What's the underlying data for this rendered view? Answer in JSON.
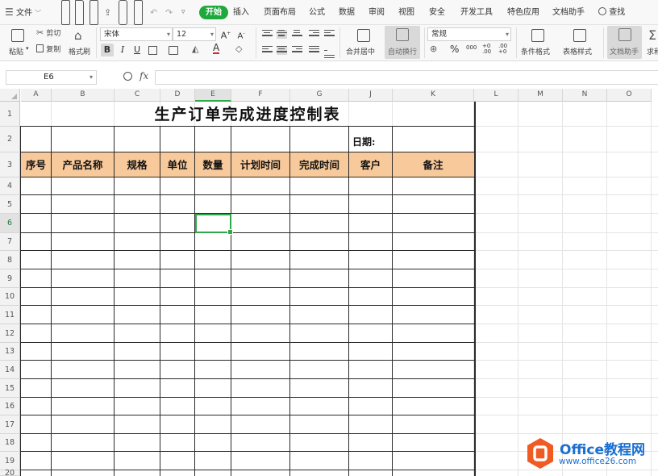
{
  "menubar": {
    "file_label": "文件",
    "tabs": [
      "开始",
      "插入",
      "页面布局",
      "公式",
      "数据",
      "审阅",
      "视图",
      "安全",
      "开发工具",
      "特色应用",
      "文档助手"
    ],
    "search_label": "查找"
  },
  "ribbon": {
    "paste_label": "粘贴",
    "cut_label": "剪切",
    "copy_label": "复制",
    "format_painter_label": "格式刷",
    "font_name": "宋体",
    "font_size": "12",
    "bold": "B",
    "italic": "I",
    "underline": "U",
    "merge_center_label": "合并居中",
    "wrap_text_label": "自动换行",
    "number_format": "常规",
    "percent": "%",
    "thousands": "000",
    "inc_decimal": "+0 .00",
    "dec_decimal": ".00 +0",
    "conditional_format_label": "条件格式",
    "table_style_label": "表格样式",
    "doc_assistant_label": "文档助手",
    "sum_label": "求和"
  },
  "formula_bar": {
    "cell_ref": "E6",
    "fx": "fx",
    "value": ""
  },
  "sheet": {
    "columns": [
      "A",
      "B",
      "C",
      "D",
      "E",
      "F",
      "G",
      "J",
      "K",
      "L",
      "M",
      "N",
      "O"
    ],
    "rows": [
      "1",
      "2",
      "3",
      "4",
      "5",
      "6",
      "7",
      "8",
      "9",
      "10",
      "11",
      "12",
      "13",
      "14",
      "15",
      "16",
      "17",
      "18",
      "19",
      "20"
    ],
    "active_cell": "E6",
    "title": "生产订单完成进度控制表",
    "date_label": "日期:",
    "headers": [
      "序号",
      "产品名称",
      "规格",
      "单位",
      "数量",
      "计划时间",
      "完成时间",
      "客户",
      "备注"
    ],
    "header_fill": "#f7c99b",
    "accent": "#2fa84a"
  },
  "watermark": {
    "brand": "Office教程网",
    "url": "www.office26.com",
    "logo_color": "#f05a23"
  }
}
